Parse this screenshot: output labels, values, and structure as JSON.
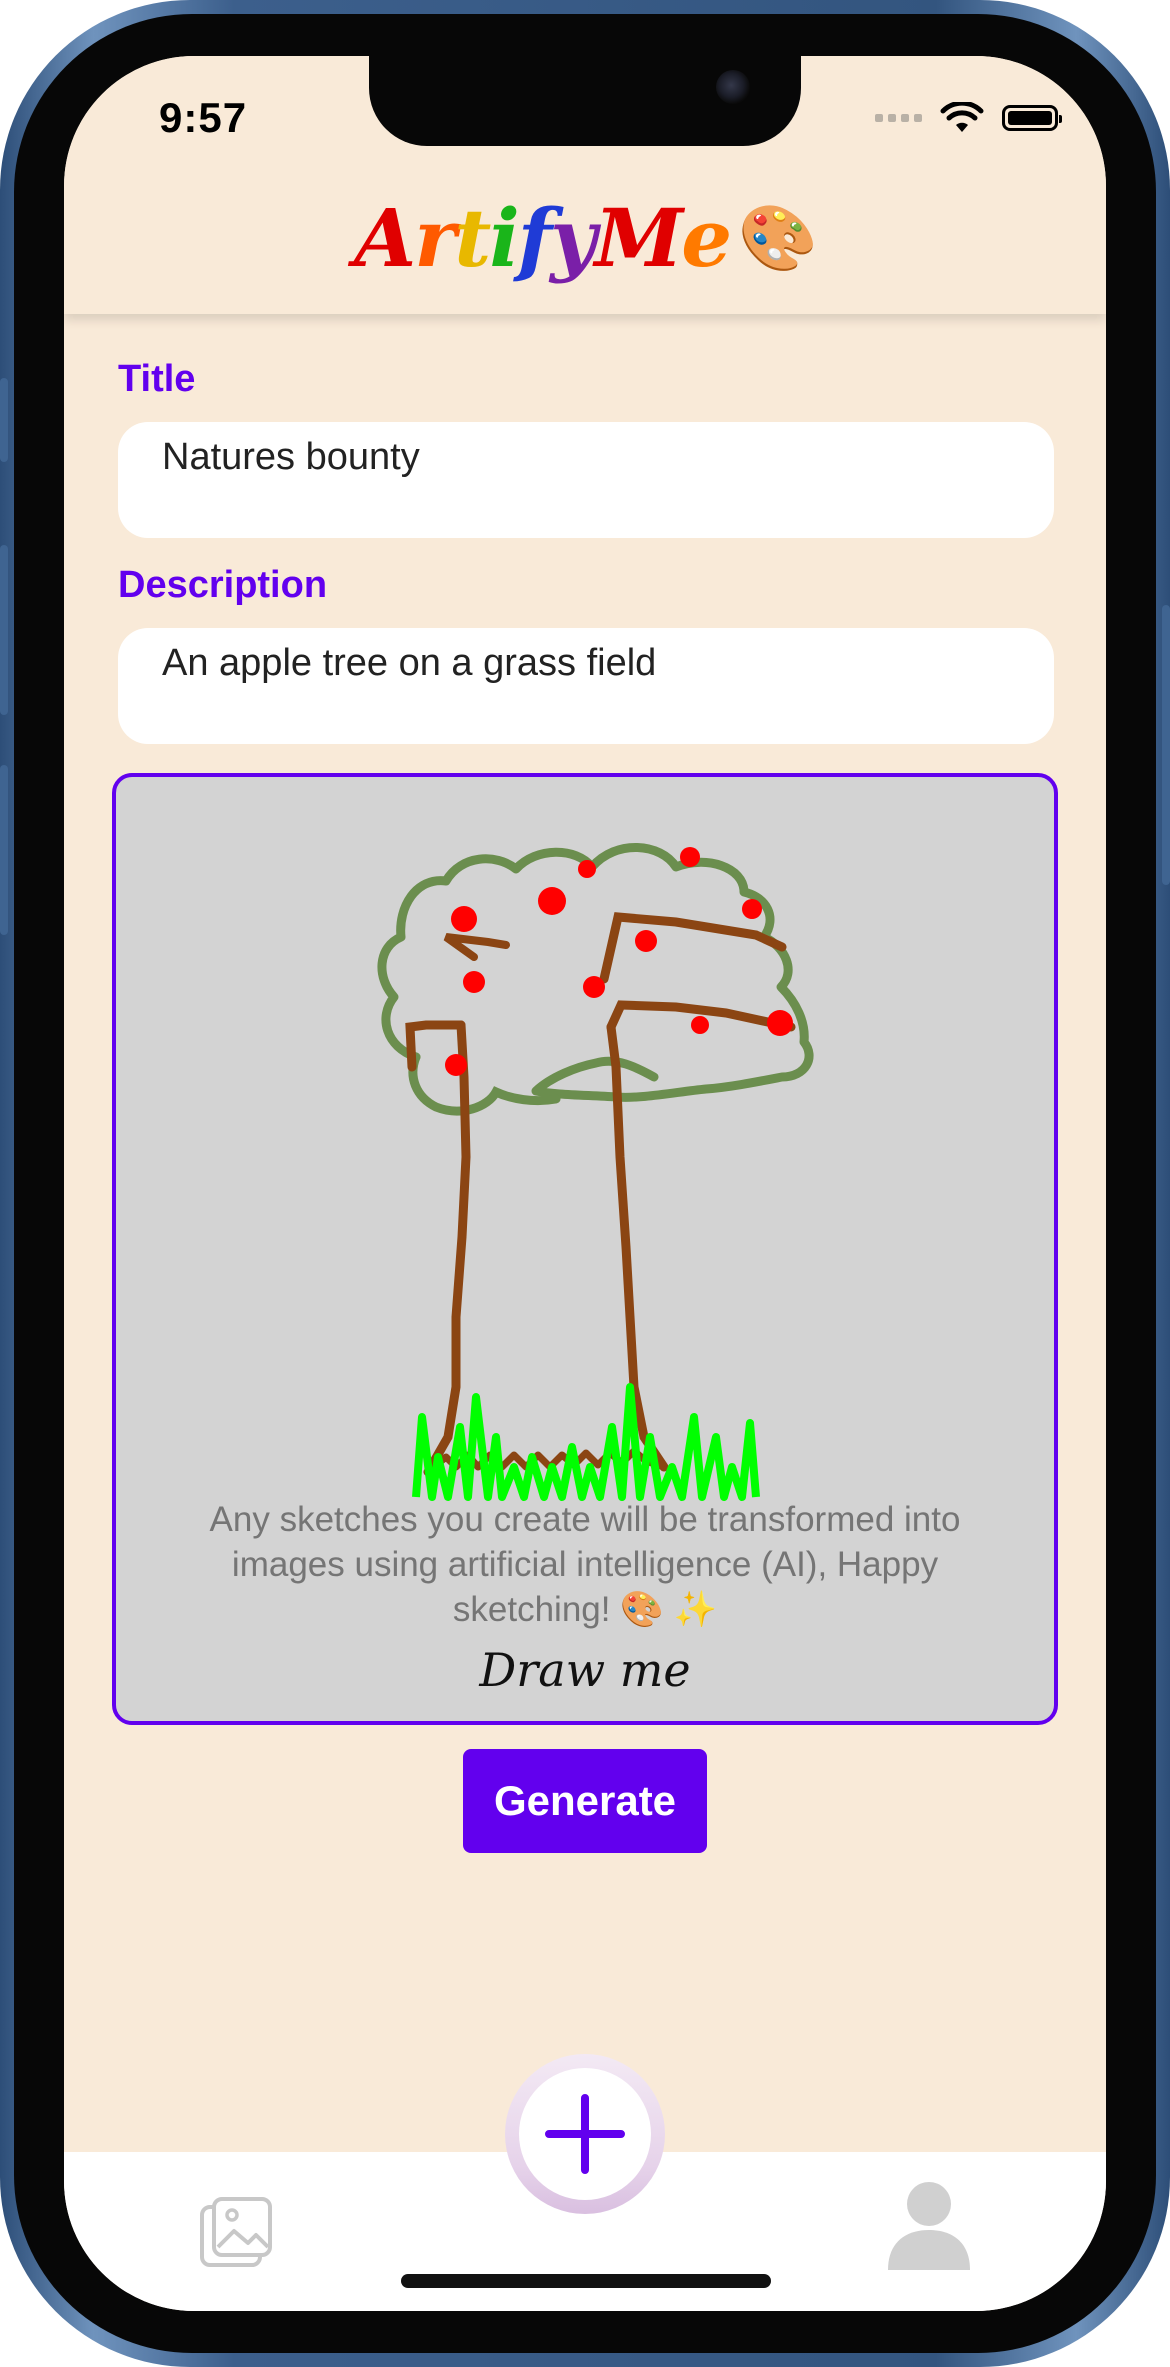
{
  "status_bar": {
    "time": "9:57"
  },
  "app": {
    "logo_letters": [
      {
        "ch": "A",
        "color": "#e00000"
      },
      {
        "ch": "r",
        "color": "#ff5a00"
      },
      {
        "ch": "t",
        "color": "#e8b800"
      },
      {
        "ch": "i",
        "color": "#1ab51a"
      },
      {
        "ch": "f",
        "color": "#1f3bd6"
      },
      {
        "ch": "y",
        "color": "#7a1fa8"
      },
      {
        "ch": "M",
        "color": "#e00000"
      },
      {
        "ch": "e",
        "color": "#ff7a00"
      }
    ],
    "logo_emoji": "🎨"
  },
  "form": {
    "title_label": "Title",
    "title_value": "Natures bounty",
    "description_label": "Description",
    "description_value": "An apple tree on a grass field"
  },
  "canvas": {
    "hint": "Any sketches you create will be transformed into images using artificial intelligence (AI), Happy sketching! 🎨 ✨",
    "draw_me": "Draw me"
  },
  "actions": {
    "generate_label": "Generate"
  },
  "tabbar": {
    "items": [
      "gallery-icon",
      "add-icon",
      "profile-icon"
    ]
  },
  "colors": {
    "accent": "#6200ee",
    "background": "#f9ead8",
    "canvas": "#d3d3d3"
  }
}
